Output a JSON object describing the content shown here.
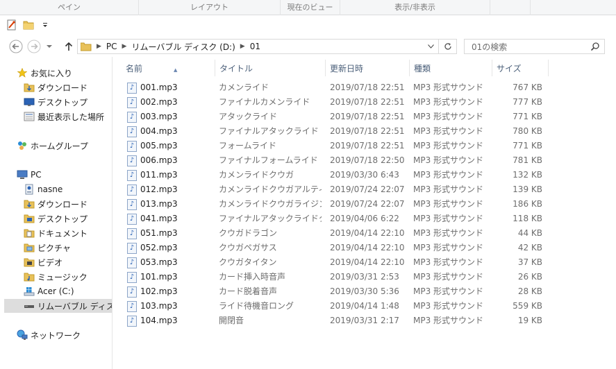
{
  "ribbon": {
    "groups": [
      "ペイン",
      "レイアウト",
      "現在のビュー",
      "表示/非表示"
    ]
  },
  "address": {
    "segments": [
      "PC",
      "リムーバブル ディスク (D:)",
      "01"
    ]
  },
  "search": {
    "placeholder": "01の検索"
  },
  "nav": {
    "favorites": {
      "label": "お気に入り",
      "items": [
        "ダウンロード",
        "デスクトップ",
        "最近表示した場所"
      ]
    },
    "homegroup": "ホームグループ",
    "pc": {
      "label": "PC",
      "items": [
        "nasne",
        "ダウンロード",
        "デスクトップ",
        "ドキュメント",
        "ピクチャ",
        "ビデオ",
        "ミュージック",
        "Acer (C:)",
        "リムーバブル ディスク (D:)"
      ]
    },
    "network": "ネットワーク"
  },
  "columns": {
    "name": "名前",
    "title": "タイトル",
    "date": "更新日時",
    "type": "種類",
    "size": "サイズ"
  },
  "files": [
    {
      "name": "001.mp3",
      "title": "カメンライド",
      "date": "2019/07/18 22:51",
      "type": "MP3 形式サウンド",
      "size": "767 KB"
    },
    {
      "name": "002.mp3",
      "title": "ファイナルカメンライド",
      "date": "2019/07/18 22:51",
      "type": "MP3 形式サウンド",
      "size": "777 KB"
    },
    {
      "name": "003.mp3",
      "title": "アタックライド",
      "date": "2019/07/18 22:51",
      "type": "MP3 形式サウンド",
      "size": "771 KB"
    },
    {
      "name": "004.mp3",
      "title": "ファイナルアタックライド",
      "date": "2019/07/18 22:51",
      "type": "MP3 形式サウンド",
      "size": "780 KB"
    },
    {
      "name": "005.mp3",
      "title": "フォームライド",
      "date": "2019/07/18 22:51",
      "type": "MP3 形式サウンド",
      "size": "771 KB"
    },
    {
      "name": "006.mp3",
      "title": "ファイナルフォームライド",
      "date": "2019/07/18 22:50",
      "type": "MP3 形式サウンド",
      "size": "781 KB"
    },
    {
      "name": "011.mp3",
      "title": "カメンライドクウガ",
      "date": "2019/03/30 6:43",
      "type": "MP3 形式サウンド",
      "size": "132 KB"
    },
    {
      "name": "012.mp3",
      "title": "カメンライドクウガアルティメット",
      "date": "2019/07/24 22:07",
      "type": "MP3 形式サウンド",
      "size": "139 KB"
    },
    {
      "name": "013.mp3",
      "title": "カメンライドクウガライジングア...",
      "date": "2019/07/24 22:07",
      "type": "MP3 形式サウンド",
      "size": "186 KB"
    },
    {
      "name": "041.mp3",
      "title": "ファイナルアタックライドクウガ",
      "date": "2019/04/06 6:22",
      "type": "MP3 形式サウンド",
      "size": "118 KB"
    },
    {
      "name": "051.mp3",
      "title": "クウガドラゴン",
      "date": "2019/04/14 22:10",
      "type": "MP3 形式サウンド",
      "size": "44 KB"
    },
    {
      "name": "052.mp3",
      "title": "クウガペガサス",
      "date": "2019/04/14 22:10",
      "type": "MP3 形式サウンド",
      "size": "42 KB"
    },
    {
      "name": "053.mp3",
      "title": "クウガタイタン",
      "date": "2019/04/14 22:10",
      "type": "MP3 形式サウンド",
      "size": "37 KB"
    },
    {
      "name": "101.mp3",
      "title": "カード挿入時音声",
      "date": "2019/03/31 2:53",
      "type": "MP3 形式サウンド",
      "size": "26 KB"
    },
    {
      "name": "102.mp3",
      "title": "カード脱着音声",
      "date": "2019/03/30 5:36",
      "type": "MP3 形式サウンド",
      "size": "28 KB"
    },
    {
      "name": "103.mp3",
      "title": "ライド待機音ロング",
      "date": "2019/04/14 1:48",
      "type": "MP3 形式サウンド",
      "size": "559 KB"
    },
    {
      "name": "104.mp3",
      "title": "開閉音",
      "date": "2019/03/31 2:17",
      "type": "MP3 形式サウンド",
      "size": "19 KB"
    }
  ]
}
